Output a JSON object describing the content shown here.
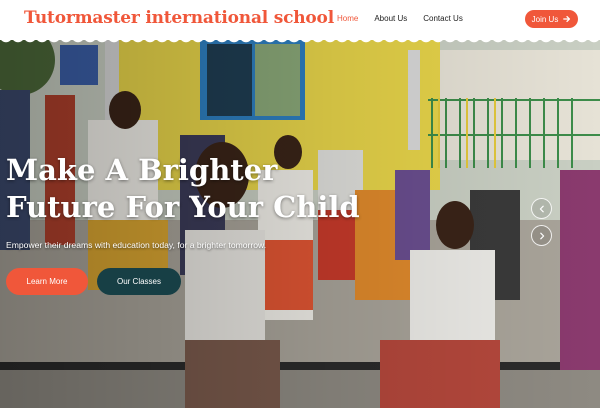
{
  "header": {
    "logo": "Tutormaster international school",
    "nav": [
      {
        "label": "Home",
        "active": true
      },
      {
        "label": "About Us",
        "active": false
      },
      {
        "label": "Contact Us",
        "active": false
      }
    ],
    "join_label": "Join Us"
  },
  "hero": {
    "headline": "Make A Brighter Future For Your Child",
    "subtitle": "Empower their dreams with education today, for a brighter tomorrow.",
    "learn_more_label": "Learn More",
    "our_classes_label": "Our Classes"
  },
  "icons": {
    "join": "arrow-right-icon",
    "prev": "chevron-left-icon",
    "next": "chevron-right-icon"
  },
  "colors": {
    "accent": "#f0573a",
    "secondary": "#173f45",
    "text": "#222222"
  }
}
